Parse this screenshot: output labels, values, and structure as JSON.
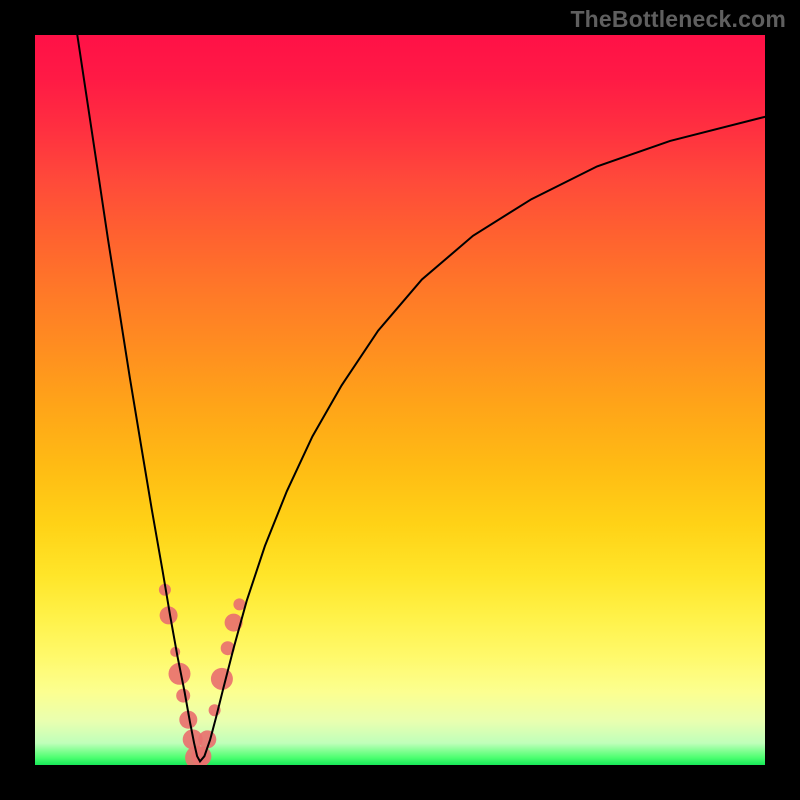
{
  "watermark": "TheBottleneck.com",
  "chart_data": {
    "type": "line",
    "title": "",
    "xlabel": "",
    "ylabel": "",
    "xlim": [
      0,
      730
    ],
    "ylim": [
      0,
      730
    ],
    "legend": false,
    "grid": false,
    "background_gradient": {
      "top_color": "#ff1147",
      "bottom_color": "#17e858",
      "description": "vertical red-to-green gradient, implying bottom (minimum of curve) is optimal"
    },
    "series": [
      {
        "name": "bottleneck-curve",
        "color": "#000000",
        "stroke_width": 2,
        "description": "Sharp V-shaped curve; steep descent on left, minimum near x≈0.22 at y≈0 (bottom/green zone), then shallower rise toward upper right",
        "x": [
          0.058,
          0.07,
          0.085,
          0.1,
          0.115,
          0.13,
          0.145,
          0.16,
          0.175,
          0.185,
          0.195,
          0.205,
          0.212,
          0.218,
          0.222,
          0.226,
          0.232,
          0.24,
          0.248,
          0.258,
          0.272,
          0.29,
          0.315,
          0.345,
          0.38,
          0.42,
          0.47,
          0.53,
          0.6,
          0.68,
          0.77,
          0.87,
          1.0
        ],
        "y": [
          1.0,
          0.92,
          0.82,
          0.72,
          0.625,
          0.53,
          0.44,
          0.35,
          0.265,
          0.205,
          0.15,
          0.1,
          0.06,
          0.03,
          0.012,
          0.005,
          0.012,
          0.035,
          0.065,
          0.105,
          0.16,
          0.225,
          0.3,
          0.375,
          0.45,
          0.52,
          0.595,
          0.665,
          0.725,
          0.775,
          0.82,
          0.855,
          0.888
        ],
        "note": "x and y are normalized to plot-area width/height (0..1), y measured from bottom (0) to top (1)"
      },
      {
        "name": "highlight-markers",
        "color": "#e9716f",
        "type": "scatter",
        "marker_radius_range": [
          4,
          12
        ],
        "description": "Pale red rounded markers clustered along the lower V of the curve, on both branches, from roughly y≈0.22 down to the minimum",
        "x": [
          0.178,
          0.183,
          0.192,
          0.198,
          0.203,
          0.21,
          0.216,
          0.222,
          0.228,
          0.236,
          0.246,
          0.256,
          0.264,
          0.272,
          0.28
        ],
        "y": [
          0.24,
          0.205,
          0.155,
          0.125,
          0.095,
          0.062,
          0.035,
          0.01,
          0.012,
          0.035,
          0.075,
          0.118,
          0.16,
          0.195,
          0.22
        ],
        "r": [
          6,
          9,
          5,
          11,
          7,
          9,
          10,
          12,
          10,
          9,
          6,
          11,
          7,
          9,
          6
        ]
      }
    ]
  }
}
